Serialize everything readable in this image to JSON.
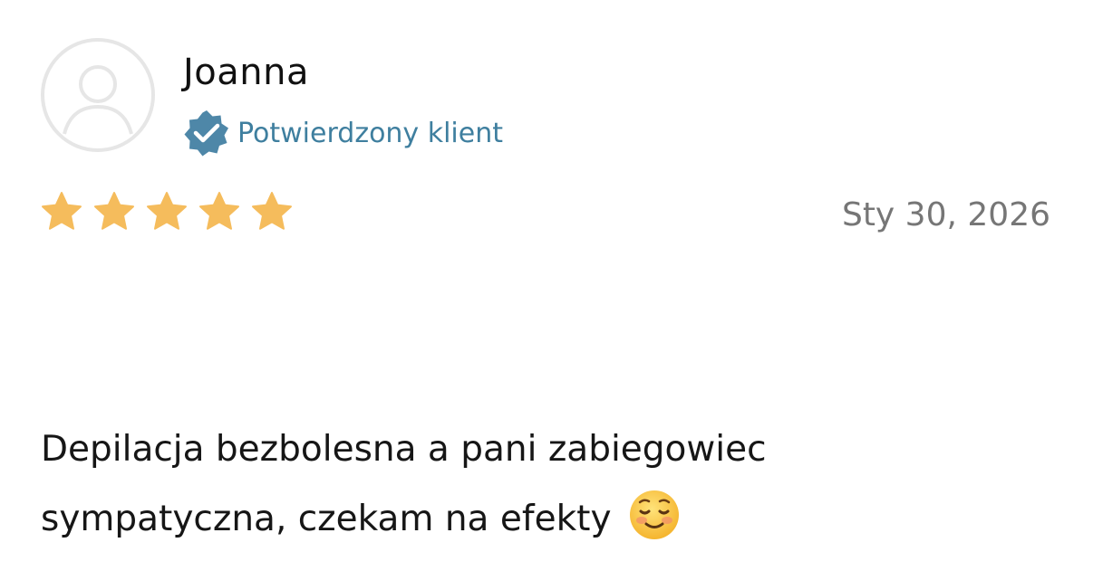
{
  "review": {
    "reviewer_name": "Joanna",
    "verified_label": "Potwierdzony klient",
    "rating": 5,
    "rating_max": 5,
    "date": "Sty 30, 2026",
    "body": "Depilacja bezbolesna a pani zabiegowiec sympatyczna, czekam na efekty",
    "emoji": "smiling-face-emoji"
  },
  "colors": {
    "star": "#F5BC5C",
    "verified_badge": "#4E87A8",
    "verified_text": "#3F7F9F",
    "date_text": "#767676",
    "avatar_outline": "#E6E6E6"
  },
  "icons": {
    "avatar": "user-avatar-icon",
    "verified": "verified-badge-icon",
    "star": "star-icon"
  }
}
